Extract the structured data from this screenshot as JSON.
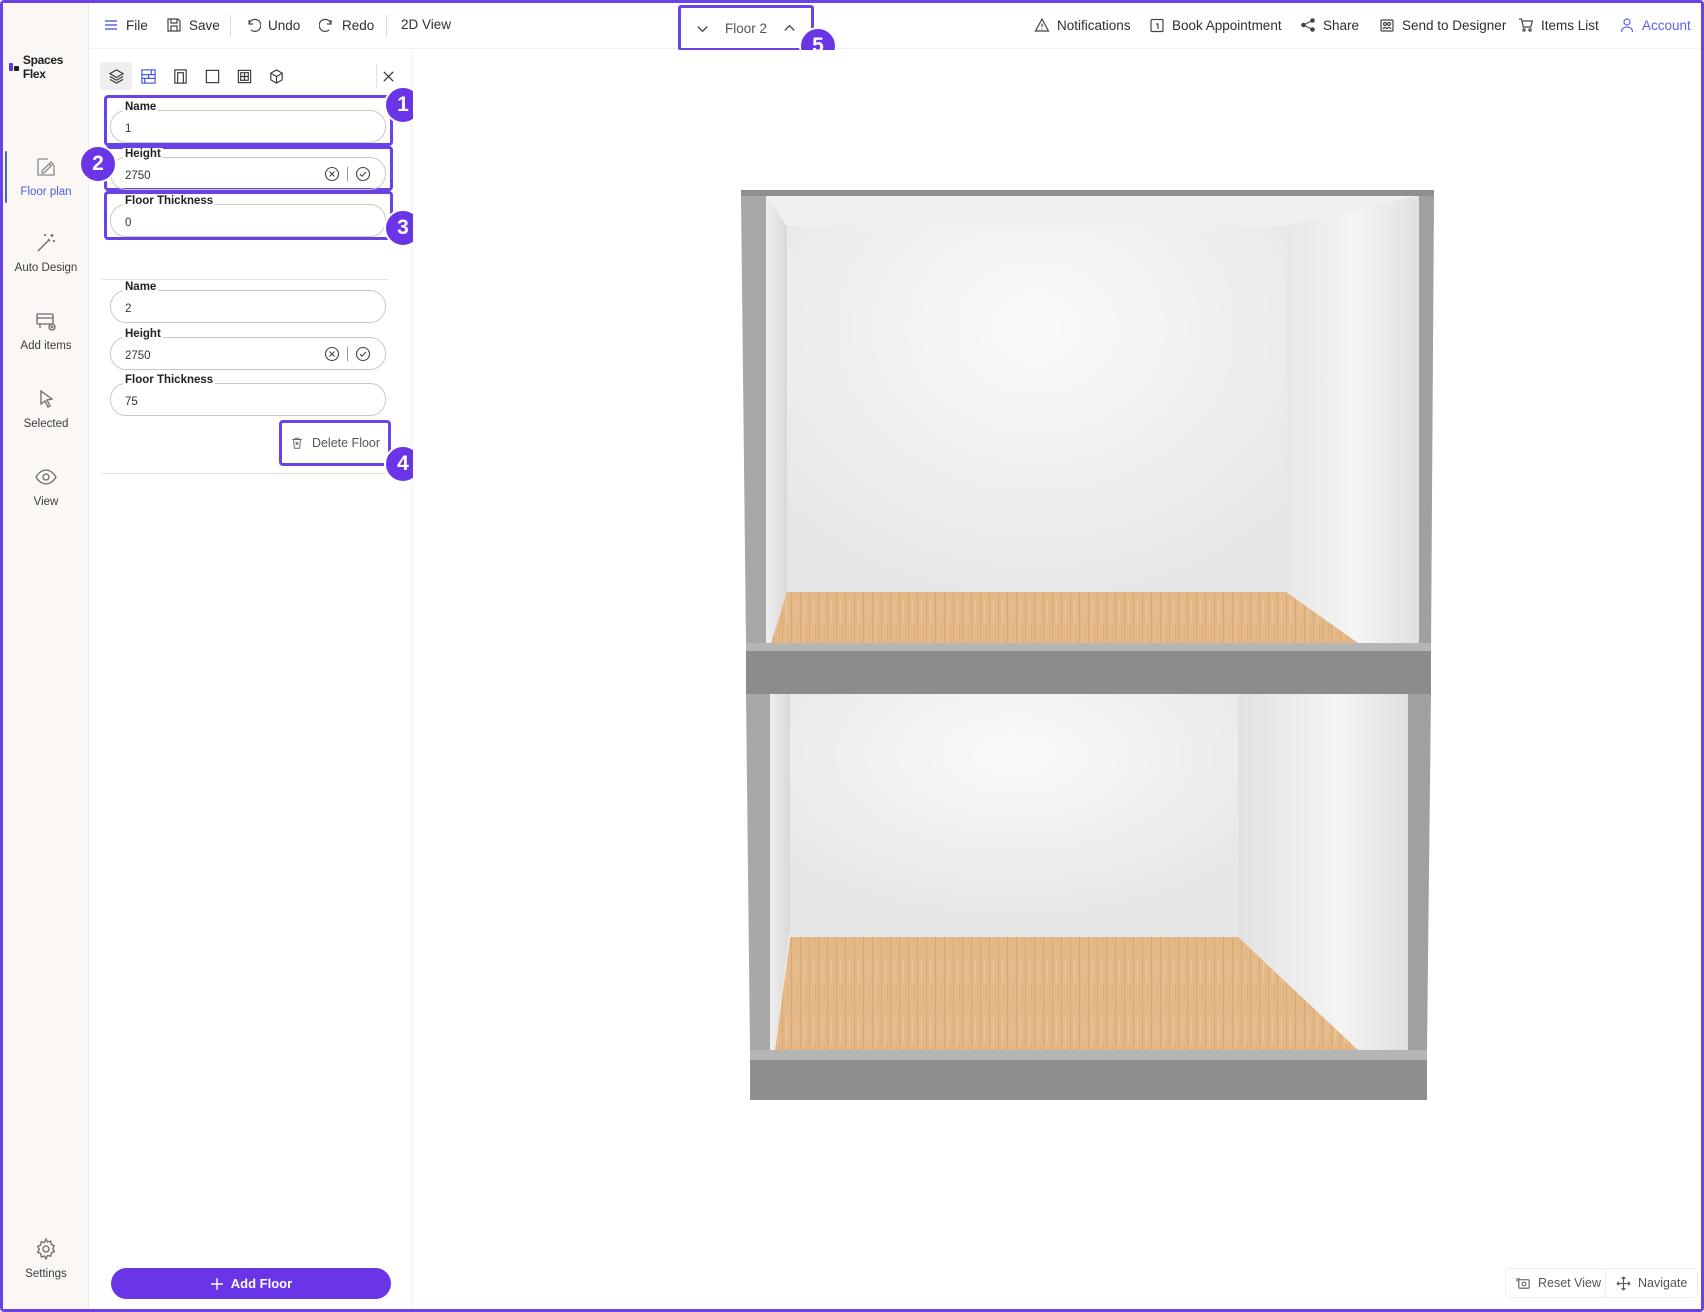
{
  "app": {
    "brand": "Spaces Flex"
  },
  "sidebar": {
    "items": [
      {
        "label": "Floor plan",
        "icon": "floor-plan-icon",
        "active": true
      },
      {
        "label": "Auto Design",
        "icon": "magic-wand-icon"
      },
      {
        "label": "Add items",
        "icon": "add-items-icon"
      },
      {
        "label": "Selected",
        "icon": "cursor-icon"
      },
      {
        "label": "View",
        "icon": "eye-icon"
      }
    ],
    "settings_label": "Settings"
  },
  "toolbar": {
    "file": "File",
    "save": "Save",
    "undo": "Undo",
    "redo": "Redo",
    "view2d": "2D View",
    "floor_selector": "Floor 2",
    "notifications": "Notifications",
    "book_appointment": "Book Appointment",
    "share": "Share",
    "send_to_designer": "Send to Designer",
    "items_list": "Items List",
    "account": "Account"
  },
  "floors": [
    {
      "name_label": "Name",
      "name_value": "1",
      "height_label": "Height",
      "height_value": "2750",
      "thickness_label": "Floor Thickness",
      "thickness_value": "0"
    },
    {
      "name_label": "Name",
      "name_value": "2",
      "height_label": "Height",
      "height_value": "2750",
      "thickness_label": "Floor Thickness",
      "thickness_value": "75"
    }
  ],
  "panel": {
    "delete_floor": "Delete Floor",
    "add_floor": "Add Floor",
    "tools": [
      "layers-icon",
      "walls-icon",
      "door-icon",
      "room-icon",
      "window-icon",
      "cube-icon"
    ]
  },
  "callouts": [
    "1",
    "2",
    "3",
    "4",
    "5"
  ],
  "viewport": {
    "reset_view": "Reset View",
    "navigate": "Navigate"
  },
  "colors": {
    "accent": "#6a35e6",
    "active_nav": "#4a5de0",
    "wall_gray": "#9e9e9e",
    "floor_wood": "#e0b483"
  }
}
